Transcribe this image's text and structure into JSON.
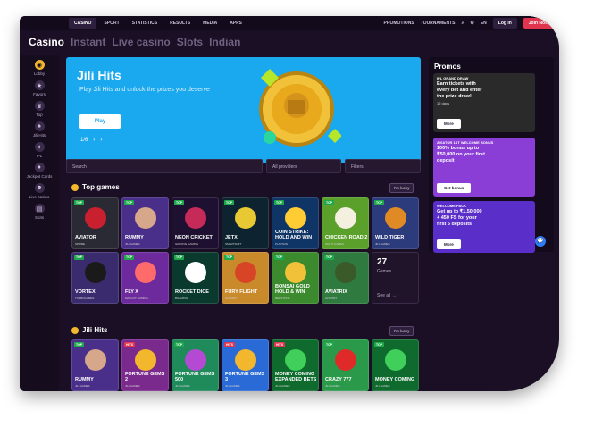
{
  "topnav": {
    "items": [
      "CASINO",
      "SPORT",
      "STATISTICS",
      "RESULTS",
      "MEDIA",
      "APPS"
    ],
    "promotions": "PROMOTIONS",
    "tournaments": "TOURNAMENTS",
    "lang": "EN",
    "login": "Log in",
    "join": "Join Now"
  },
  "subnav": [
    "Casino",
    "Instant",
    "Live casino",
    "Slots",
    "Indian"
  ],
  "sidebar": [
    "Lobby",
    "Favors",
    "Top",
    "Jili Hits",
    "IPL",
    "Jackpot Cards",
    "Live-casino",
    "Slots"
  ],
  "hero": {
    "title": "Jili Hits",
    "subtitle": "Play Jili Hits and unlock the prizes you deserve",
    "play": "Play",
    "page": "1/6"
  },
  "filters": {
    "search": "Search",
    "providers": "All providers",
    "filters": "Filters"
  },
  "top_games": {
    "title": "Top games",
    "lucky": "I'm lucky",
    "more_count": "27",
    "more_label": "Games",
    "see_all": "See all →",
    "cards": [
      {
        "name": "AVIATOR",
        "sub": "SPRIBE",
        "bg": "#2a2a35",
        "art": "#c8202e"
      },
      {
        "name": "RUMMY",
        "sub": "JILI GAMES",
        "bg": "#4a2f8a",
        "art": "#d6a78a"
      },
      {
        "name": "NEON CRICKET",
        "sub": "GROOVE GAMING",
        "bg": "#1d1030",
        "art": "#c62a58"
      },
      {
        "name": "JETX",
        "sub": "SMARTSOFT",
        "bg": "#0d2430",
        "art": "#e8c833"
      },
      {
        "name": "COIN STRIKE: HOLD AND WIN",
        "sub": "PLAYSON",
        "bg": "#0f3466",
        "art": "#ffcc33"
      },
      {
        "name": "CHICKEN ROAD 2",
        "sub": "INOUT GAMES",
        "bg": "#5ba02a",
        "art": "#f4f0e0"
      },
      {
        "name": "WILD TIGER",
        "sub": "JILI GAMES",
        "bg": "#2c3b7c",
        "art": "#e08a25"
      },
      {
        "name": "VORTEX",
        "sub": "TURBOGAMES",
        "bg": "#3a2b6e",
        "art": "#1a1a1a"
      },
      {
        "name": "FLY X",
        "sub": "MASCOT GAMING",
        "bg": "#6c2a9c",
        "art": "#ff6b6b"
      },
      {
        "name": "ROCKET DICE",
        "sub": "BGAMING",
        "bg": "#0a3a2e",
        "art": "#ffffff"
      },
      {
        "name": "FURY FLIGHT",
        "sub": "AVIATRIX",
        "bg": "#c88a2a",
        "art": "#d84526"
      },
      {
        "name": "BONSAI GOLD HOLD & WIN",
        "sub": "REDSTONE",
        "bg": "#3b8a2e",
        "art": "#f2c13a"
      },
      {
        "name": "AVIATRIX",
        "sub": "AVIATRIX",
        "bg": "#2f7a3e",
        "art": "#3a5a2a"
      }
    ]
  },
  "jili_hits": {
    "title": "Jili Hits",
    "lucky": "I'm lucky",
    "cards": [
      {
        "name": "RUMMY",
        "sub": "JILI GAMES",
        "tag": "TOP",
        "bg": "#4a2f8a",
        "art": "#d6a78a"
      },
      {
        "name": "FORTUNE GEMS 2",
        "sub": "JILI GAMES",
        "tag": "HITS",
        "bg": "#7a2a8c",
        "art": "#f2b72c"
      },
      {
        "name": "FORTUNE GEMS 500",
        "sub": "JILI GAMES",
        "tag": "TOP",
        "bg": "#1f8a5a",
        "art": "#b44ad4"
      },
      {
        "name": "FORTUNE GEMS 3",
        "sub": "JILI GAMES",
        "tag": "HITS",
        "bg": "#2a6ad6",
        "art": "#f2b72c"
      },
      {
        "name": "MONEY COMING EXPANDED BETS",
        "sub": "JILI GAMES",
        "tag": "HITS",
        "bg": "#0f6a2e",
        "art": "#3fcf5a"
      },
      {
        "name": "CRAZY 777",
        "sub": "JILI GAMES",
        "tag": "TOP",
        "bg": "#2a9a4a",
        "art": "#e02a2a"
      },
      {
        "name": "MONEY COMING",
        "sub": "JILI GAMES",
        "tag": "TOP",
        "bg": "#0f6a2e",
        "art": "#3fcf5a"
      }
    ]
  },
  "promos": {
    "title": "Promos",
    "items": [
      {
        "tag": "IPL GRAND DRAW",
        "text": "Earn tickets with every bet and enter the prize draw!",
        "time": "12 days",
        "button": "More",
        "bg": "#2a2a2a"
      },
      {
        "tag": "AVIATOR 1ST WELCOME BONUS",
        "text": "100% bonus up to ₹50,000 on your first deposit",
        "time": "",
        "button": "Get bonus",
        "bg": "#8a3ed6"
      },
      {
        "tag": "WELCOME PACK",
        "text": "Get up to ₹1,50,000 + 450 FS for your first 5 deposits",
        "time": "",
        "button": "More",
        "bg": "#5a2ec8"
      }
    ]
  }
}
